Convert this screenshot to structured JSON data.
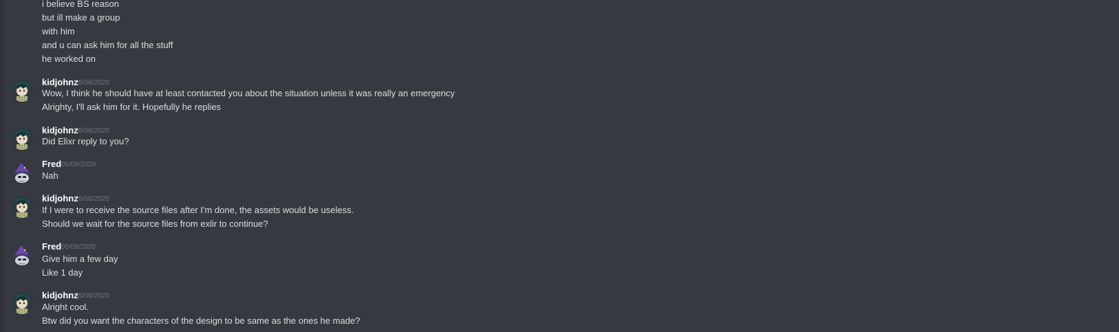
{
  "messages": [
    {
      "lines": [
        "i believe BS reason",
        "but ill make a group",
        "with him",
        "and u can ask him for all the stuff",
        "he worked on"
      ]
    },
    {
      "author": "kidjohnz",
      "timestamp": "05/08/2020",
      "avatar": "kidjohnz-avatar",
      "lines": [
        "Wow, I think he should have at least contacted you about the situation unless it was really an emergency",
        "Alrighty, I'll ask him for it. Hopefully he replies"
      ]
    },
    {
      "author": "kidjohnz",
      "timestamp": "05/08/2020",
      "avatar": "kidjohnz-avatar",
      "lines": [
        "Did Elixr reply to you?"
      ]
    },
    {
      "author": "Fred",
      "timestamp": "05/08/2020",
      "avatar": "fred-avatar",
      "lines": [
        "Nah"
      ]
    },
    {
      "author": "kidjohnz",
      "timestamp": "05/08/2020",
      "avatar": "kidjohnz-avatar",
      "lines": [
        "If I were to receive the source files after I'm done, the assets would be useless.",
        "Should we wait for the source files from exlir to continue?"
      ]
    },
    {
      "author": "Fred",
      "timestamp": "05/08/2020",
      "avatar": "fred-avatar",
      "lines": [
        "Give him a few day",
        "Like 1 day"
      ]
    },
    {
      "author": "kidjohnz",
      "timestamp": "05/08/2020",
      "avatar": "kidjohnz-avatar",
      "lines": [
        "Alright cool.",
        "Btw did you want the characters of the design to be same as the ones he made?"
      ]
    }
  ],
  "colors": {
    "background": "#36393f",
    "message_text": "#dcddde",
    "author_text": "#ffffff",
    "timestamp_text": "#72767d"
  }
}
